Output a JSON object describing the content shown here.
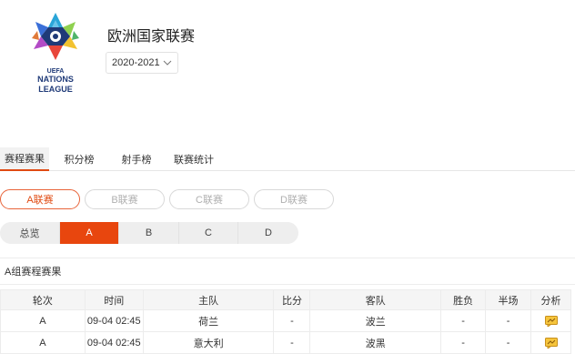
{
  "league": {
    "logo_text": [
      "UEFA",
      "NATIONS",
      "LEAGUE"
    ],
    "title": "欧洲国家联赛",
    "season": "2020-2021"
  },
  "tabs": [
    "赛程赛果",
    "积分榜",
    "射手榜",
    "联赛统计"
  ],
  "league_pills": [
    "A联赛",
    "B联赛",
    "C联赛",
    "D联赛"
  ],
  "groups": [
    "总览",
    "A",
    "B",
    "C",
    "D"
  ],
  "section_title": "A组赛程赛果",
  "table": {
    "headers": [
      "轮次",
      "时间",
      "主队",
      "比分",
      "客队",
      "胜负",
      "半场",
      "分析"
    ],
    "rows": [
      [
        "A",
        "09-04 02:45",
        "荷兰",
        "-",
        "波兰",
        "-",
        "-"
      ],
      [
        "A",
        "09-04 02:45",
        "意大利",
        "-",
        "波黑",
        "-",
        "-"
      ]
    ]
  },
  "colors": {
    "accent": "#e8460e",
    "icon_fill": "#f6c53c"
  },
  "icons": [
    "chevron-down-icon",
    "analysis-icon"
  ]
}
